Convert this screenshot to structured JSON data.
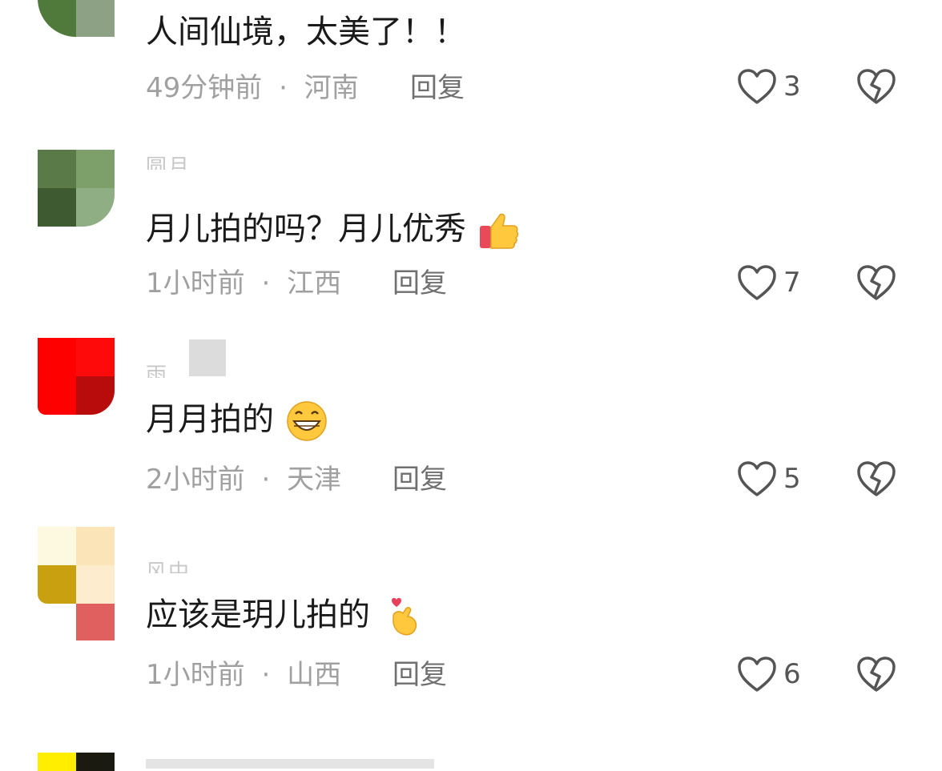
{
  "comments": [
    {
      "username": "",
      "text": "人间仙境，太美了！！",
      "time": "49分钟前",
      "location": "河南",
      "reply_label": "回复",
      "likes": "3"
    },
    {
      "username": "圆月",
      "text": "月儿拍的吗？月儿优秀",
      "emoji": "thumbs-up",
      "time": "1小时前",
      "location": "江西",
      "reply_label": "回复",
      "likes": "7"
    },
    {
      "username": "雨",
      "text": "月月拍的",
      "emoji": "grinning-face",
      "time": "2小时前",
      "location": "天津",
      "reply_label": "回复",
      "likes": "5"
    },
    {
      "username": "风中",
      "text": "应该是玥儿拍的",
      "emoji": "finger-heart",
      "time": "1小时前",
      "location": "山西",
      "reply_label": "回复",
      "likes": "6"
    },
    {
      "username": "",
      "text": "",
      "time": "",
      "location": "",
      "reply_label": "",
      "likes": ""
    }
  ],
  "separator": "·",
  "colors": {
    "text": "#1a1a1a",
    "meta": "#a0a0a0",
    "reply": "#707070",
    "icon": "#555555"
  }
}
